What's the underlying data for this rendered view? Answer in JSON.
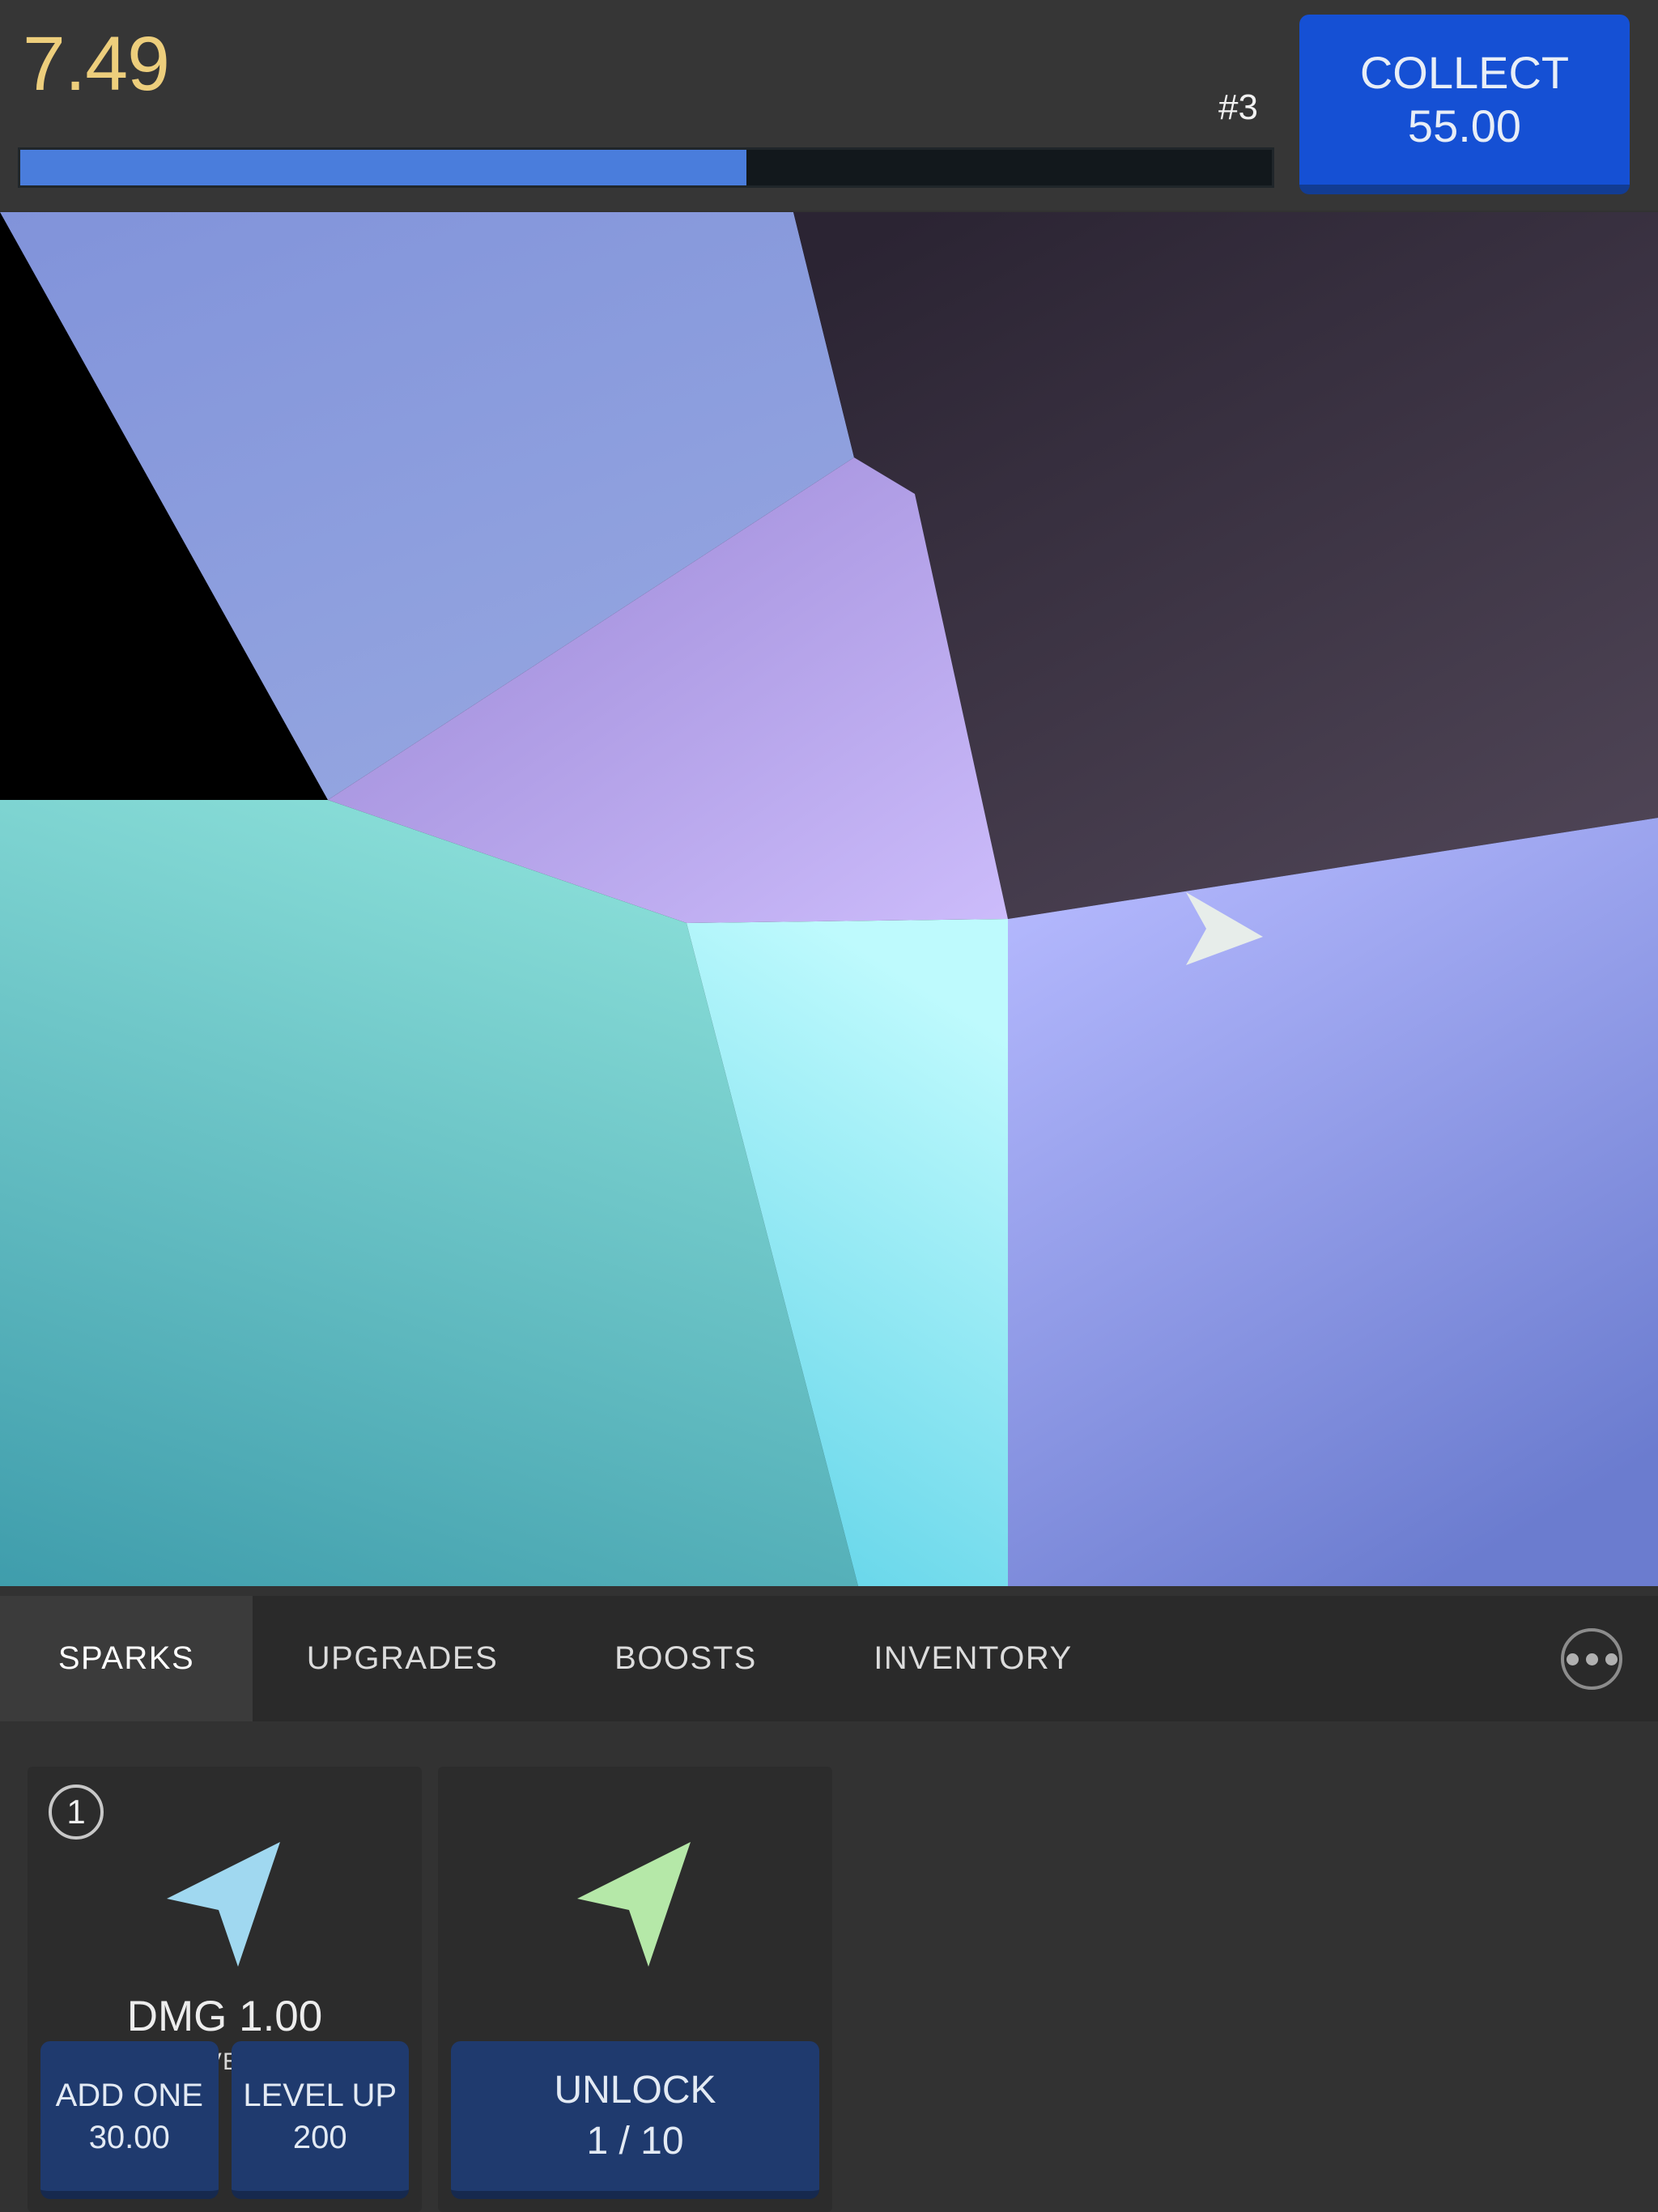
{
  "hud": {
    "score": "7.49",
    "wave_label": "#3",
    "progress_percent": 58,
    "collect": {
      "label": "COLLECT",
      "amount": "55.00"
    }
  },
  "game": {
    "cursor_icon": "arrow-cursor-icon",
    "cells": [
      {
        "name": "cell-blue-top-left",
        "color_from": "#7f93d6",
        "color_to": "#8fa0dd"
      },
      {
        "name": "cell-dark-top-right",
        "color_from": "#2d2636",
        "color_to": "#4b4152"
      },
      {
        "name": "cell-purple-mid",
        "color_from": "#9b87d6",
        "color_to": "#c6b6f7"
      },
      {
        "name": "cell-teal-left",
        "color_from": "#7ad6d2",
        "color_to": "#42a0ae"
      },
      {
        "name": "cell-cyan-center",
        "color_from": "#b6f4fd",
        "color_to": "#63d7ea"
      },
      {
        "name": "cell-periwinkle-right",
        "color_from": "#b2b6fb",
        "color_to": "#6f7fd2"
      }
    ]
  },
  "tabs": [
    {
      "label": "SPARKS",
      "active": true
    },
    {
      "label": "UPGRADES",
      "active": false
    },
    {
      "label": "BOOSTS",
      "active": false
    },
    {
      "label": "INVENTORY",
      "active": false
    }
  ],
  "more_menu_label": "more-options",
  "cards": [
    {
      "badge": "1",
      "arrow_color": "#a0d8f0",
      "title": "DMG 1.00",
      "subtitle": "LEVEL 0",
      "buttons": [
        {
          "label": "ADD ONE",
          "value": "30.00"
        },
        {
          "label": "LEVEL UP",
          "value": "200"
        }
      ]
    },
    {
      "badge": "",
      "arrow_color": "#b5e8a8",
      "title": "",
      "subtitle": "",
      "buttons": [
        {
          "label": "UNLOCK",
          "value": "1 / 10"
        }
      ]
    }
  ]
}
